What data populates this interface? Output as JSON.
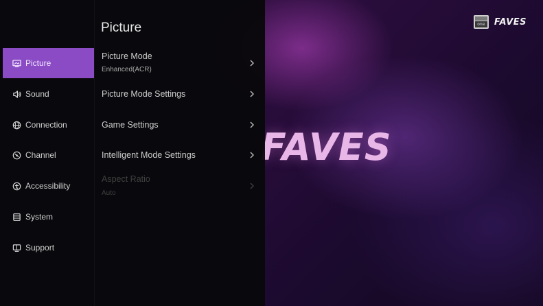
{
  "background": {
    "hero_title": "FAVES",
    "brand": {
      "logo_text": "one",
      "name": "FAVES"
    }
  },
  "menu": {
    "title": "Picture",
    "sidebar": {
      "items": [
        {
          "label": "Picture",
          "icon": "picture-icon",
          "active": true
        },
        {
          "label": "Sound",
          "icon": "speaker-icon"
        },
        {
          "label": "Connection",
          "icon": "globe-icon"
        },
        {
          "label": "Channel",
          "icon": "channel-icon"
        },
        {
          "label": "Accessibility",
          "icon": "accessibility-icon"
        },
        {
          "label": "System",
          "icon": "system-icon"
        },
        {
          "label": "Support",
          "icon": "support-icon"
        }
      ]
    },
    "options": [
      {
        "label": "Picture Mode",
        "value": "Enhanced(ACR)",
        "icon": "chevron-right-icon"
      },
      {
        "label": "Picture Mode Settings",
        "icon": "chevron-right-icon"
      },
      {
        "label": "Game Settings",
        "icon": "chevron-right-icon"
      },
      {
        "label": "Intelligent Mode Settings",
        "icon": "chevron-right-icon"
      },
      {
        "label": "Aspect Ratio",
        "value": "Auto",
        "disabled": true,
        "icon": "chevron-right-icon"
      }
    ]
  },
  "colors": {
    "accent": "#8a4bc4",
    "panel": "#08080a",
    "hero_text": "#e9b6e8"
  }
}
